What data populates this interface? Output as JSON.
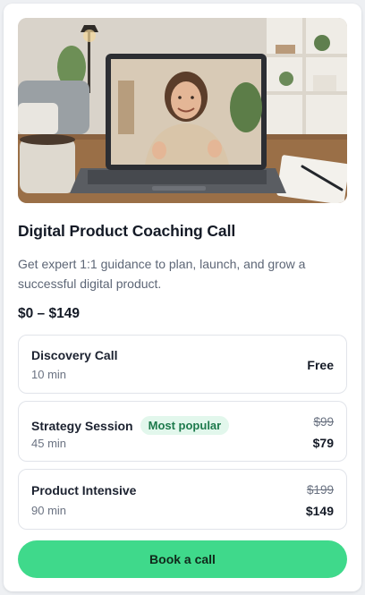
{
  "product": {
    "title": "Digital Product Coaching Call",
    "description": "Get expert 1:1 guidance to plan, launch, and grow a successful digital product.",
    "price_range": "$0 – $149"
  },
  "options": [
    {
      "name": "Discovery Call",
      "duration": "10 min",
      "price": "Free"
    },
    {
      "name": "Strategy Session",
      "badge": "Most popular",
      "duration": "45 min",
      "original_price": "$99",
      "price": "$79"
    },
    {
      "name": "Product Intensive",
      "duration": "90 min",
      "original_price": "$199",
      "price": "$149"
    }
  ],
  "cta": {
    "label": "Book a call"
  },
  "colors": {
    "accent": "#3fd98b",
    "badge_bg": "#e2f7ec",
    "badge_text": "#1d7a4c"
  }
}
